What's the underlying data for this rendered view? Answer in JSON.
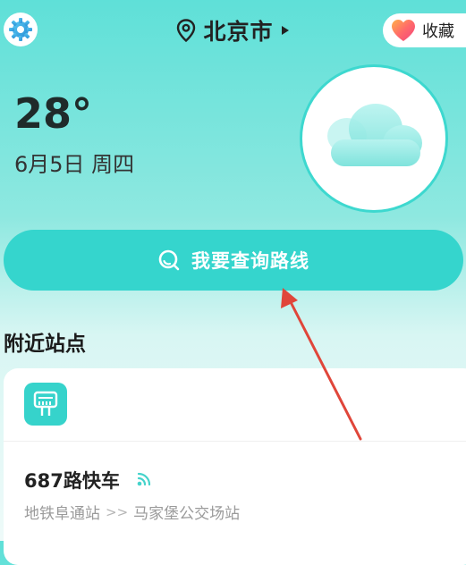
{
  "header": {
    "city": "北京市",
    "favorite_label": "收藏"
  },
  "weather": {
    "temperature": "28°",
    "date": "6月5日 周四",
    "condition_icon": "cloud-icon"
  },
  "search": {
    "label": "我要查询路线"
  },
  "nearby": {
    "title": "附近站点",
    "routes": [
      {
        "name": "687路快车",
        "from": "地铁阜通站",
        "separator": ">>",
        "to": "马家堡公交场站"
      }
    ]
  },
  "icons": {
    "settings": "gear-icon",
    "location": "location-pin-icon",
    "dropdown": "triangle-right-icon",
    "favorite": "heart-icon",
    "search": "search-icon",
    "bus_stop": "bus-stop-icon",
    "realtime": "signal-icon"
  },
  "colors": {
    "accent": "#35d5cd",
    "annotation_arrow": "#e0463a"
  }
}
